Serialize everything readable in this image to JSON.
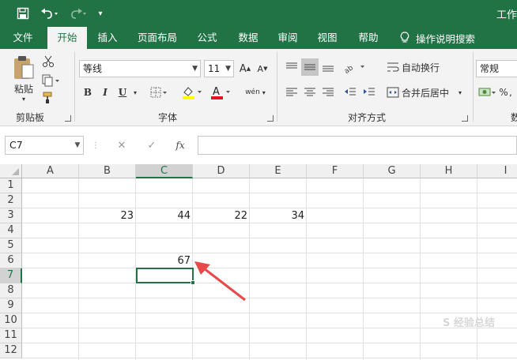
{
  "title_bar": {
    "doc_title": "工作",
    "quick_access": [
      {
        "icon": "save-icon",
        "glyph": "💾"
      },
      {
        "icon": "undo-icon",
        "glyph": "↶"
      },
      {
        "icon": "redo-icon",
        "glyph": "↷"
      },
      {
        "icon": "customize-qat-icon",
        "glyph": "▾"
      }
    ]
  },
  "tabs": {
    "items": [
      "文件",
      "开始",
      "插入",
      "页面布局",
      "公式",
      "数据",
      "审阅",
      "视图",
      "帮助"
    ],
    "active": "开始",
    "help_search_icon": "lightbulb-icon",
    "help_search": "操作说明搜索"
  },
  "ribbon": {
    "clipboard": {
      "paste_label": "粘贴",
      "group_label": "剪贴板"
    },
    "font": {
      "font_name": "等线",
      "font_size": "11",
      "group_label": "字体",
      "bold": "B",
      "italic": "I",
      "underline": "U",
      "font_color_glyph": "A",
      "phonetic_glyph": "wén"
    },
    "alignment": {
      "wrap_text": "自动换行",
      "merge_center": "合并后居中",
      "group_label": "对齐方式"
    },
    "number": {
      "format": "常规",
      "group_label": "数"
    }
  },
  "formula_bar": {
    "name_box": "C7",
    "cancel_glyph": "✕",
    "enter_glyph": "✓",
    "fx_glyph": "fx",
    "formula": ""
  },
  "grid": {
    "columns": [
      "A",
      "B",
      "C",
      "D",
      "E",
      "F",
      "G",
      "H",
      "I"
    ],
    "rows": [
      "1",
      "2",
      "3",
      "4",
      "5",
      "6",
      "7",
      "8",
      "9",
      "10",
      "11",
      "12"
    ],
    "active_cell": "C7",
    "cells": {
      "B3": "23",
      "C3": "44",
      "D3": "22",
      "E3": "34",
      "C6": "67"
    }
  },
  "annotation": {
    "type": "red-arrow",
    "points_to": "C6",
    "color": "#e8494a"
  },
  "watermark": "S 经验总结",
  "colors": {
    "brand": "#217346",
    "ribbon_bg": "#f3f3f3",
    "arrow": "#e8494a"
  }
}
